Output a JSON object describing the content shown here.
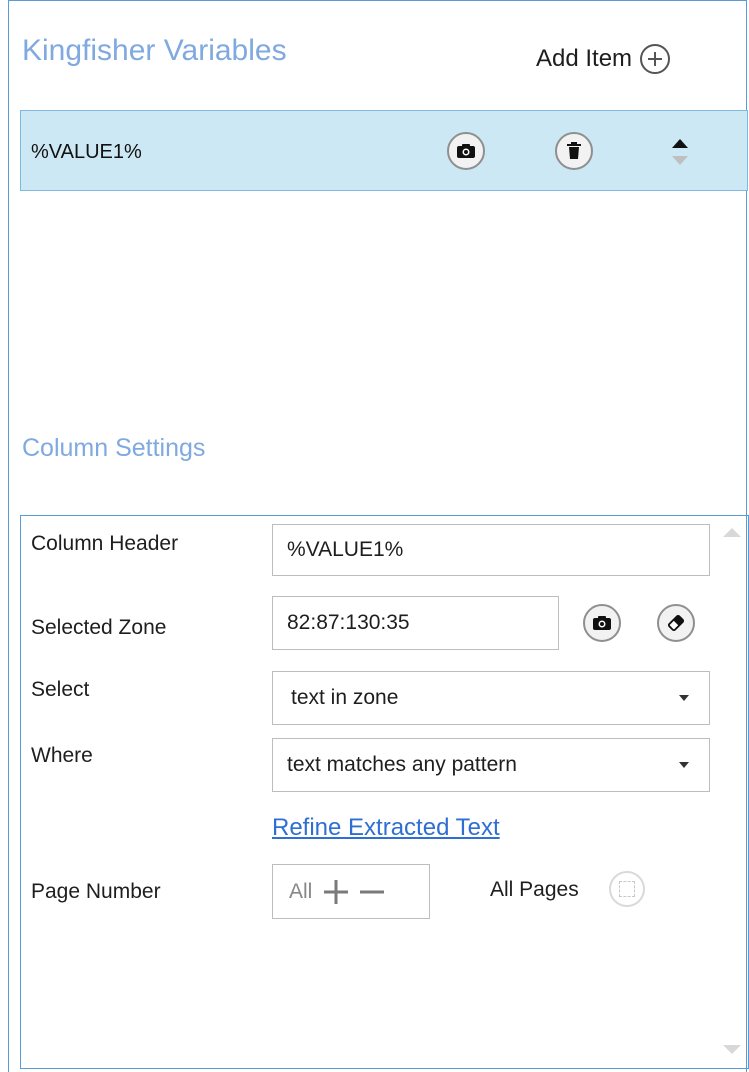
{
  "panel": {
    "title": "Kingfisher Variables",
    "add_item_label": "Add Item"
  },
  "variables": {
    "items": [
      {
        "name": "%VALUE1%"
      }
    ]
  },
  "column_settings": {
    "title": "Column Settings",
    "column_header_label": "Column Header",
    "column_header_value": "%VALUE1%",
    "selected_zone_label": "Selected Zone",
    "selected_zone_value": "82:87:130:35",
    "select_label": "Select",
    "select_value": "text in zone",
    "where_label": "Where",
    "where_value": "text matches any pattern",
    "refine_link": "Refine Extracted Text",
    "page_number_label": "Page Number",
    "page_number_value": "All",
    "all_pages_label": "All Pages"
  },
  "icons": [
    "plus-circle-icon",
    "camera-icon",
    "trash-icon",
    "sort-arrows-icon",
    "eraser-icon",
    "plus-icon",
    "minus-icon",
    "all-pages-icon"
  ],
  "colors": {
    "accent_title": "#7fa9df",
    "selected_row": "#cde8f5",
    "border": "#5b9bd5",
    "link": "#2f6fd3"
  }
}
